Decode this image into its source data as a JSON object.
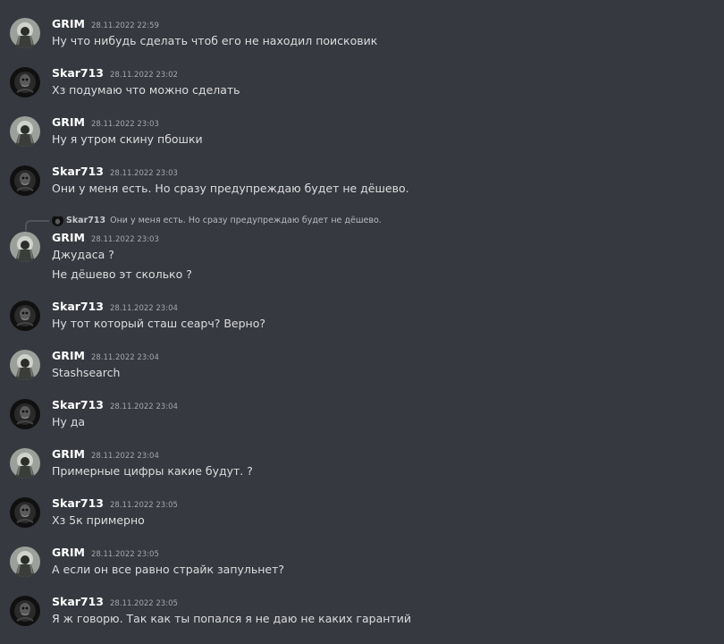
{
  "messages": [
    {
      "username": "GRIM",
      "avatar": "grim-avatar",
      "timestamp": "28.11.2022 22:59",
      "lines": [
        "Ну что нибудь сделать чтоб его не находил поисковик"
      ]
    },
    {
      "username": "Skar713",
      "avatar": "skar-avatar",
      "timestamp": "28.11.2022 23:02",
      "lines": [
        "Хз подумаю что можно сделать"
      ]
    },
    {
      "username": "GRIM",
      "avatar": "grim-avatar",
      "timestamp": "28.11.2022 23:03",
      "lines": [
        "Ну я утром скину пбошки"
      ]
    },
    {
      "username": "Skar713",
      "avatar": "skar-avatar",
      "timestamp": "28.11.2022 23:03",
      "lines": [
        "Они у меня есть. Но сразу предупреждаю будет не дёшево."
      ]
    },
    {
      "username": "GRIM",
      "avatar": "grim-avatar",
      "timestamp": "28.11.2022 23:03",
      "lines": [
        "Джудаса ?",
        "Не дёшево эт сколько ?"
      ],
      "reply": {
        "username": "Skar713",
        "text": "Они у меня есть. Но сразу предупреждаю будет не дёшево."
      }
    },
    {
      "username": "Skar713",
      "avatar": "skar-avatar",
      "timestamp": "28.11.2022 23:04",
      "lines": [
        "Ну тот который сташ сеарч? Верно?"
      ]
    },
    {
      "username": "GRIM",
      "avatar": "grim-avatar",
      "timestamp": "28.11.2022 23:04",
      "lines": [
        "Stashsearch"
      ]
    },
    {
      "username": "Skar713",
      "avatar": "skar-avatar",
      "timestamp": "28.11.2022 23:04",
      "lines": [
        "Ну да"
      ]
    },
    {
      "username": "GRIM",
      "avatar": "grim-avatar",
      "timestamp": "28.11.2022 23:04",
      "lines": [
        "Примерные цифры какие будут. ?"
      ]
    },
    {
      "username": "Skar713",
      "avatar": "skar-avatar",
      "timestamp": "28.11.2022 23:05",
      "lines": [
        "Хз 5к примерно"
      ]
    },
    {
      "username": "GRIM",
      "avatar": "grim-avatar",
      "timestamp": "28.11.2022 23:05",
      "lines": [
        "А если он все равно страйк запульнет?"
      ]
    },
    {
      "username": "Skar713",
      "avatar": "skar-avatar",
      "timestamp": "28.11.2022 23:05",
      "lines": [
        "Я ж говорю. Так как ты попался я не даю не каких гарантий"
      ]
    }
  ],
  "colors": {
    "background": "#36393f",
    "username": "#ffffff",
    "timestamp": "#a3a6aa",
    "message_text": "#dcddde"
  }
}
